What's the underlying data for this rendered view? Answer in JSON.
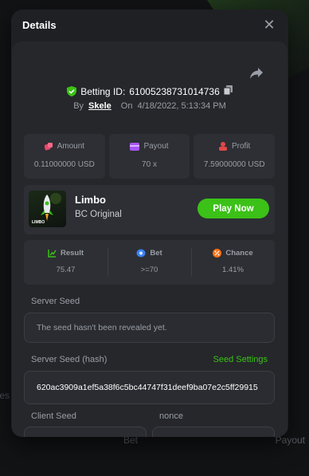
{
  "background": {
    "left_text": "tes",
    "bet_label": "Bet",
    "payout_label": "Payout"
  },
  "modal": {
    "title": "Details",
    "close_glyph": "✕"
  },
  "bet": {
    "betting_id_label": "Betting ID:",
    "betting_id": "61005238731014736",
    "by_label": "By",
    "user": "Skele",
    "on_label": "On",
    "timestamp": "4/18/2022, 5:13:34 PM"
  },
  "stats": [
    {
      "label": "Amount",
      "value": "0.11000000 USD",
      "icon": "dice-icon",
      "color": "#e8476a"
    },
    {
      "label": "Payout",
      "value": "70 x",
      "icon": "wallet-icon",
      "color": "#a855f7"
    },
    {
      "label": "Profit",
      "value": "7.59000000 USD",
      "icon": "coins-icon",
      "color": "#e04848"
    }
  ],
  "game": {
    "name": "Limbo",
    "provider": "BC Original",
    "thumb_text": "LIMBO",
    "play_label": "Play Now"
  },
  "results": [
    {
      "label": "Result",
      "value": "75.47",
      "icon": "chart-icon",
      "color": "#3bc117"
    },
    {
      "label": "Bet",
      "value": ">=70",
      "icon": "target-icon",
      "color": "#3b82f6"
    },
    {
      "label": "Chance",
      "value": "1.41%",
      "icon": "percent-icon",
      "color": "#f97316"
    }
  ],
  "server_seed": {
    "label": "Server Seed",
    "value": "The seed hasn't been revealed yet."
  },
  "server_seed_hash": {
    "label": "Server Seed (hash)",
    "settings_label": "Seed Settings",
    "value": "620ac3909a1ef5a38f6c5bc44747f31deef9ba07e2c5ff29915"
  },
  "client_seed": {
    "label": "Client Seed"
  },
  "nonce": {
    "label": "nonce"
  },
  "colors": {
    "accent": "#3bc117",
    "panel": "#25272b",
    "modal": "#1f2024"
  }
}
